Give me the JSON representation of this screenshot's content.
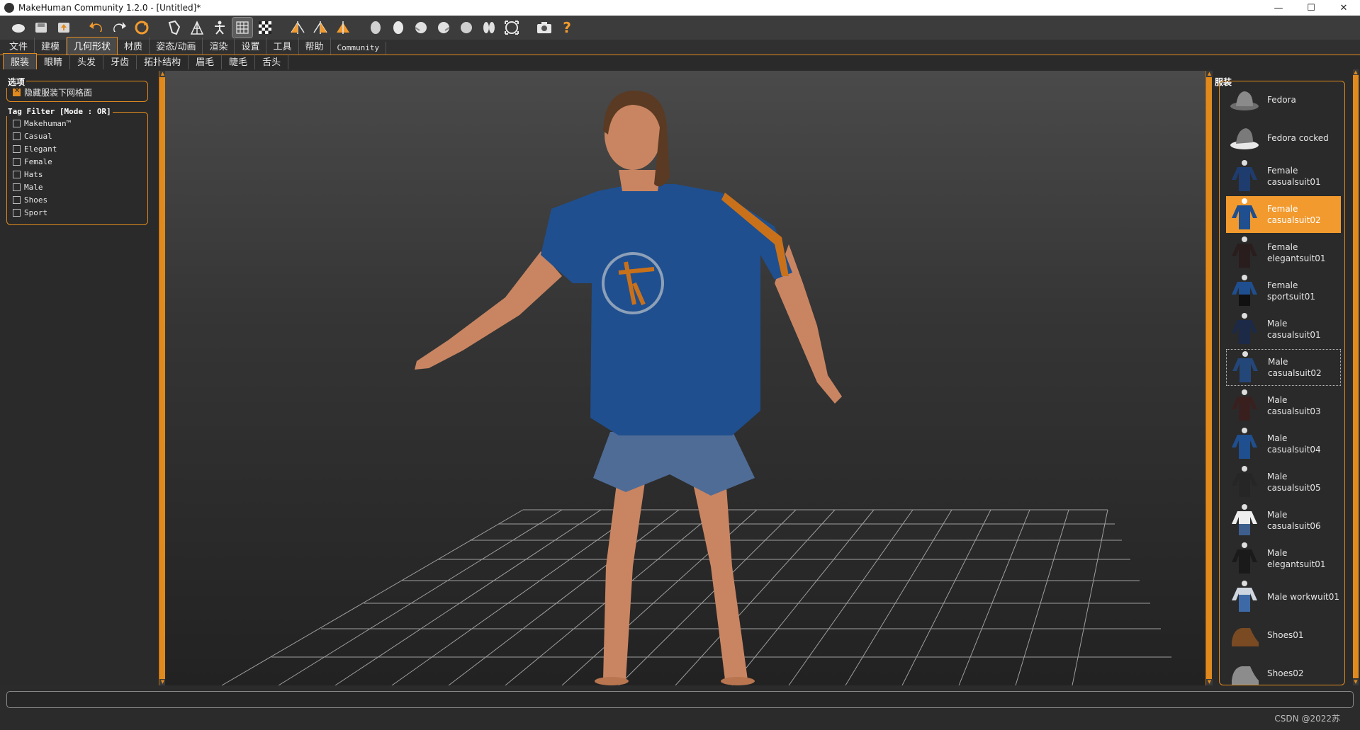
{
  "window": {
    "title": "MakeHuman Community 1.2.0 - [Untitled]*",
    "controls": [
      "—",
      "☐",
      "✕"
    ]
  },
  "toolbar": {
    "icons": [
      "undo-icon",
      "redo-icon",
      "reset-icon",
      "pose-icon",
      "wireframe-icon",
      "skeleton-icon",
      "grid-icon",
      "checker-icon",
      "symmetry-icon",
      "help-icon"
    ],
    "help_glyph": "?"
  },
  "menu": {
    "tabs": [
      "文件",
      "建模",
      "几何形状",
      "材质",
      "姿态/动画",
      "渲染",
      "设置",
      "工具",
      "帮助",
      "Community"
    ],
    "active_index": 2
  },
  "subtabs": {
    "tabs": [
      "服装",
      "眼睛",
      "头发",
      "牙齿",
      "拓扑结构",
      "眉毛",
      "睫毛",
      "舌头"
    ],
    "active_index": 0
  },
  "left": {
    "options_title": "选项",
    "hide_faces_label": "隐藏服装下网格面",
    "hide_faces_checked": true,
    "tag_filter_title": "Tag Filter [Mode : OR]",
    "tags": [
      "Makehuman™",
      "Casual",
      "Elegant",
      "Female",
      "Hats",
      "Male",
      "Shoes",
      "Sport"
    ]
  },
  "right": {
    "title": "服装",
    "items": [
      {
        "line1": "Fedora",
        "line2": "",
        "thumb": "hat"
      },
      {
        "line1": "Fedora cocked",
        "line2": "",
        "thumb": "hat"
      },
      {
        "line1": "Female",
        "line2": "casualsuit01",
        "thumb": "suit-blue"
      },
      {
        "line1": "Female",
        "line2": "casualsuit02",
        "thumb": "suit-blue"
      },
      {
        "line1": "Female",
        "line2": "elegantsuit01",
        "thumb": "suit-dark"
      },
      {
        "line1": "Female",
        "line2": "sportsuit01",
        "thumb": "suit-sport"
      },
      {
        "line1": "Male",
        "line2": "casualsuit01",
        "thumb": "suit-navy"
      },
      {
        "line1": "Male",
        "line2": "casualsuit02",
        "thumb": "suit-blue"
      },
      {
        "line1": "Male",
        "line2": "casualsuit03",
        "thumb": "suit-brown"
      },
      {
        "line1": "Male",
        "line2": "casualsuit04",
        "thumb": "suit-blue"
      },
      {
        "line1": "Male",
        "line2": "casualsuit05",
        "thumb": "suit-dark"
      },
      {
        "line1": "Male",
        "line2": "casualsuit06",
        "thumb": "suit-white"
      },
      {
        "line1": "Male",
        "line2": "elegantsuit01",
        "thumb": "suit-dark"
      },
      {
        "line1": "Male workwuit01",
        "line2": "",
        "thumb": "suit-work"
      },
      {
        "line1": "Shoes01",
        "line2": "",
        "thumb": "shoe-brown"
      },
      {
        "line1": "Shoes02",
        "line2": "",
        "thumb": "shoe-grey"
      }
    ],
    "selected_index": 3,
    "focused_index": 7
  },
  "colors": {
    "accent": "#e08a1e",
    "selected": "#f29a2e",
    "shirt": "#1f4f8f",
    "skin": "#c98562",
    "shorts": "#4f6c96"
  },
  "footer": {
    "watermark": "CSDN @2022苏"
  }
}
